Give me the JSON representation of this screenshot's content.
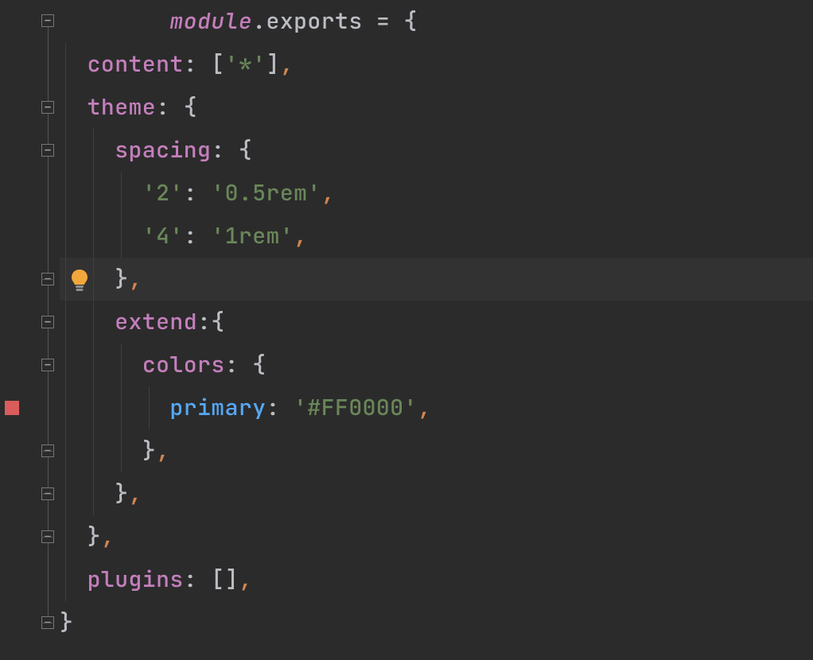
{
  "colors": {
    "bg": "#2b2b2b",
    "highlight": "#323232",
    "keyword": "#c47fbc",
    "string": "#6a8759",
    "identifier": "#56a8f5",
    "comma": "#d08552",
    "default": "#bcbec4",
    "breakpoint": "#db5c5c",
    "bulb": "#f2a73d"
  },
  "icons": {
    "lightbulb": "lightbulb-icon",
    "fold_minus": "−",
    "fold_end": ""
  },
  "code": {
    "l1": {
      "module": "module",
      "dot": ".",
      "exports": "exports",
      "eq": " = ",
      "brace": "{"
    },
    "l2": {
      "key": "content",
      "colon": ": ",
      "open": "[",
      "val": "'*'",
      "close": "]",
      "comma": ","
    },
    "l3": {
      "key": "theme",
      "colon": ": ",
      "brace": "{"
    },
    "l4": {
      "key": "spacing",
      "colon": ": ",
      "brace": "{"
    },
    "l5": {
      "key": "'2'",
      "colon": ": ",
      "val": "'0.5rem'",
      "comma": ","
    },
    "l6": {
      "key": "'4'",
      "colon": ": ",
      "val": "'1rem'",
      "comma": ","
    },
    "l7": {
      "brace": "}",
      "comma": ","
    },
    "l8": {
      "key": "extend",
      "colon": ":",
      "brace": "{"
    },
    "l9": {
      "key": "colors",
      "colon": ": ",
      "brace": "{"
    },
    "l10": {
      "key": "primary",
      "colon": ": ",
      "val": "'#FF0000'",
      "comma": ","
    },
    "l11": {
      "brace": "}",
      "comma": ","
    },
    "l12": {
      "brace": "}",
      "comma": ","
    },
    "l13": {
      "brace": "}",
      "comma": ","
    },
    "l14": {
      "key": "plugins",
      "colon": ": ",
      "open": "[",
      "close": "]",
      "comma": ","
    },
    "l15": {
      "brace": "}"
    }
  }
}
